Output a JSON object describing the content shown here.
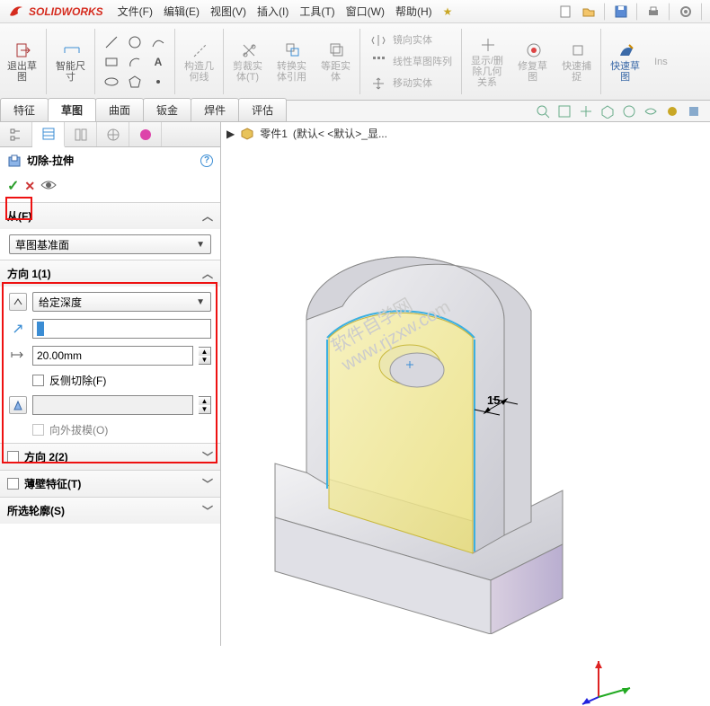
{
  "app": {
    "brand": "SOLIDWORKS"
  },
  "menus": [
    "文件(F)",
    "编辑(E)",
    "视图(V)",
    "插入(I)",
    "工具(T)",
    "窗口(W)",
    "帮助(H)"
  ],
  "ribbon": {
    "exit": {
      "label": "退出草\n图"
    },
    "smart": {
      "label": "智能尺\n寸"
    },
    "curve": {
      "label": "构造几\n何线"
    },
    "trim": {
      "label": "剪裁实\n体(T)"
    },
    "convert": {
      "label": "转换实\n体引用"
    },
    "offset": {
      "label": "等距实\n体"
    },
    "mirror": {
      "label": "镜向实体"
    },
    "pattern": {
      "label": "线性草图阵列"
    },
    "move": {
      "label": "移动实体"
    },
    "show": {
      "label": "显示/删\n除几何\n关系"
    },
    "repair": {
      "label": "修复草\n图"
    },
    "snap": {
      "label": "快速捕\n捉"
    },
    "quick": {
      "label": "快速草\n图"
    },
    "inst": {
      "label": "Ins"
    }
  },
  "tabs": [
    "特征",
    "草图",
    "曲面",
    "钣金",
    "焊件",
    "评估"
  ],
  "active_tab": "草图",
  "breadcrumb": {
    "part": "零件1",
    "state": "(默认< <默认>_显..."
  },
  "feature": {
    "title": "切除-拉伸",
    "from_label": "从(F)",
    "from_value": "草图基准面",
    "dir1_label": "方向 1(1)",
    "dir1_type": "给定深度",
    "depth_value": "20.00mm",
    "flip_label": "反侧切除(F)",
    "draft_label": "向外拔模(O)",
    "dir2_label": "方向 2(2)",
    "thin_label": "薄壁特征(T)",
    "contour_label": "所选轮廓(S)"
  },
  "dimension": {
    "d1": "15"
  }
}
